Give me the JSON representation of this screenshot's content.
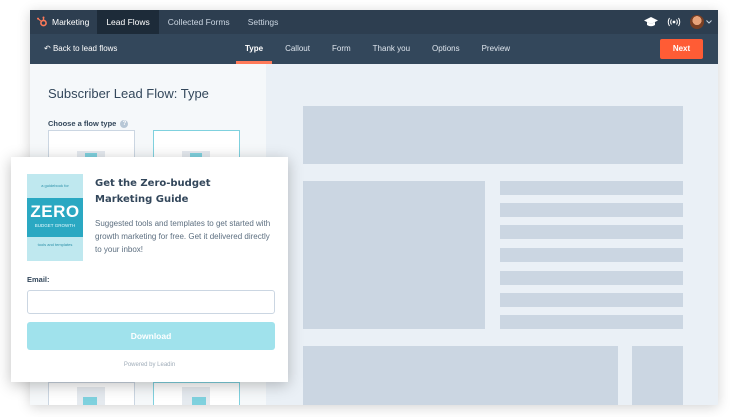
{
  "topnav": {
    "brand": "Marketing",
    "items": [
      {
        "label": "Lead Flows",
        "active": true
      },
      {
        "label": "Collected Forms",
        "active": false
      },
      {
        "label": "Settings",
        "active": false
      }
    ],
    "icons": [
      "academy-icon",
      "broadcast-icon",
      "avatar",
      "chevron-down-icon"
    ]
  },
  "subbar": {
    "back_label": "Back to lead flows",
    "tabs": [
      {
        "label": "Type",
        "active": true
      },
      {
        "label": "Callout",
        "active": false
      },
      {
        "label": "Form",
        "active": false
      },
      {
        "label": "Thank you",
        "active": false
      },
      {
        "label": "Options",
        "active": false
      },
      {
        "label": "Preview",
        "active": false
      }
    ],
    "next_label": "Next"
  },
  "left": {
    "title": "Subscriber Lead Flow: Type",
    "flow_label": "Choose a flow type",
    "help_glyph": "?"
  },
  "popup": {
    "book": {
      "top_text": "a guidebook for",
      "big": "ZERO",
      "band_sub": "BUDGET GROWTH",
      "bottom_text": "tools and templates"
    },
    "title": "Get the Zero-budget Marketing Guide",
    "description": "Suggested tools and templates to get started with growth marketing for free. Get it delivered directly to your inbox!",
    "email_label": "Email:",
    "email_value": "",
    "button_label": "Download",
    "powered_by": "Powered by Leadin"
  },
  "colors": {
    "nav_bg": "#2d3e50",
    "subbar_bg": "#33475b",
    "accent_orange": "#ff5c35",
    "teal": "#2aa8c2",
    "button_light_teal": "#a0e2ec",
    "placeholder_block": "#cbd6e2"
  }
}
